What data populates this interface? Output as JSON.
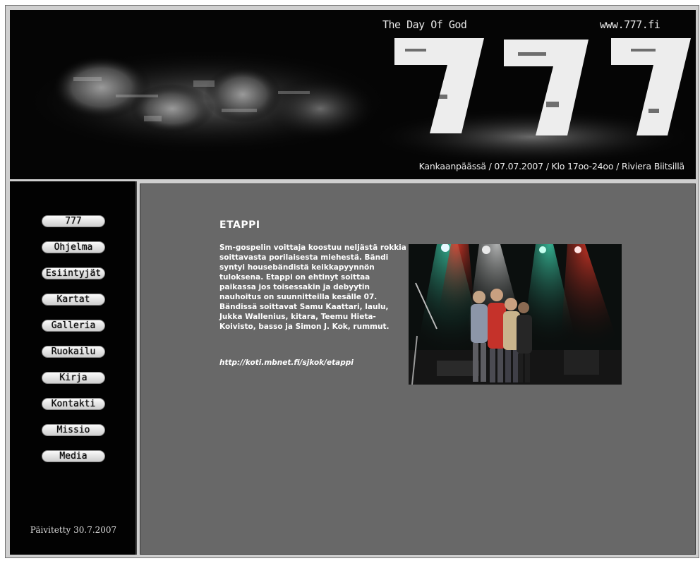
{
  "header": {
    "tagline": "The Day Of God",
    "site_url": "www.777.fi",
    "logo_text": "777",
    "event_line": "Kankaanpäässä / 07.07.2007 / Klo 17oo-24oo / Riviera Biitsillä"
  },
  "nav": {
    "items": [
      {
        "label": "777"
      },
      {
        "label": "Ohjelma"
      },
      {
        "label": "Esiintyjät"
      },
      {
        "label": "Kartat"
      },
      {
        "label": "Galleria"
      },
      {
        "label": "Ruokailu"
      },
      {
        "label": "Kirja"
      },
      {
        "label": "Kontakti"
      },
      {
        "label": "Missio"
      },
      {
        "label": "Media"
      }
    ],
    "updated": "Päivitetty 30.7.2007"
  },
  "content": {
    "title": "ETAPPI",
    "body": "Sm-gospelin voittaja koostuu neljästä rokkia soittavasta porilaisesta miehestä. Bändi syntyi housebändistä keikkapyynnön tuloksena. Etappi on ehtinyt soittaa paikassa jos toisessakin ja debyytin nauhoitus on suunnitteilla kesälle 07. Bändissä soittavat Samu Kaattari, laulu, Jukka Wallenius, kitara, Teemu Hieta-Koivisto, basso ja Simon J. Kok, rummut.",
    "link": "http://koti.mbnet.fi/sjkok/etappi"
  },
  "colors": {
    "page_background": "#ffffff",
    "header_background": "#050505",
    "sidebar_background": "#020202",
    "content_background": "#686868",
    "content_text": "#ffffff"
  }
}
